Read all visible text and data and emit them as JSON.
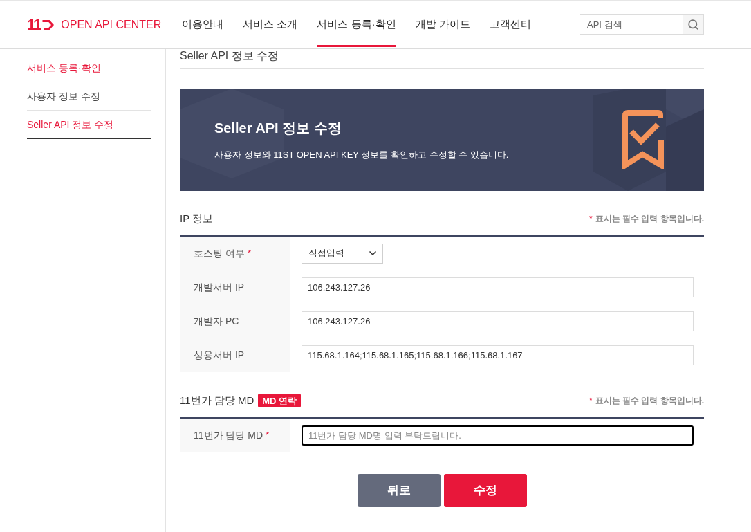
{
  "header": {
    "logo": {
      "number": "11",
      "title": "OPEN API CENTER"
    },
    "nav": [
      {
        "label": "이용안내",
        "selected": false
      },
      {
        "label": "서비스 소개",
        "selected": false
      },
      {
        "label": "서비스 등록·확인",
        "selected": true
      },
      {
        "label": "개발 가이드",
        "selected": false
      },
      {
        "label": "고객센터",
        "selected": false
      }
    ],
    "search": {
      "placeholder": "API 검색"
    }
  },
  "sidebar": {
    "items": [
      {
        "label": "서비스 등록·확인",
        "selected": true
      },
      {
        "label": "사용자 정보 수정",
        "selected": false
      },
      {
        "label": "Seller API 정보 수정",
        "selected": true
      }
    ]
  },
  "page_title": "Seller API 정보 수정",
  "banner": {
    "title": "Seller API 정보 수정",
    "description": "사용자 정보와 11ST OPEN API KEY 정보를 확인하고 수정할 수 있습니다."
  },
  "sections": [
    {
      "title": "IP 정보",
      "note": {
        "mark": "*",
        "text": "표시는 필수 입력 항목입니다."
      },
      "rows": [
        {
          "label": "호스팅 여부",
          "mark": "*",
          "kind": "select",
          "value": "직접입력",
          "focused": false
        },
        {
          "label": "개발서버 IP",
          "kind": "input",
          "value": "106.243.127.26",
          "focused": false
        },
        {
          "label": "개발자 PC",
          "kind": "input",
          "value": "106.243.127.26",
          "focused": false
        },
        {
          "label": "상용서버 IP",
          "kind": "input",
          "value": "115.68.1.164;115.68.1.165;115.68.1.166;115.68.1.167",
          "focused": false
        }
      ]
    },
    {
      "title": "11번가 담당 MD",
      "badge": "MD 연락",
      "note": {
        "mark": "*",
        "text": "표시는 필수 입력 항목입니다."
      },
      "rows": [
        {
          "label": "11번가 담당 MD",
          "mark": "*",
          "kind": "input",
          "placeholder": "11번가 담당 MD명 입력 부탁드립니다.",
          "focused": true
        }
      ]
    }
  ],
  "buttons": [
    {
      "label": "뒤로",
      "kind": "secondary"
    },
    {
      "label": "수정",
      "kind": "primary"
    }
  ]
}
